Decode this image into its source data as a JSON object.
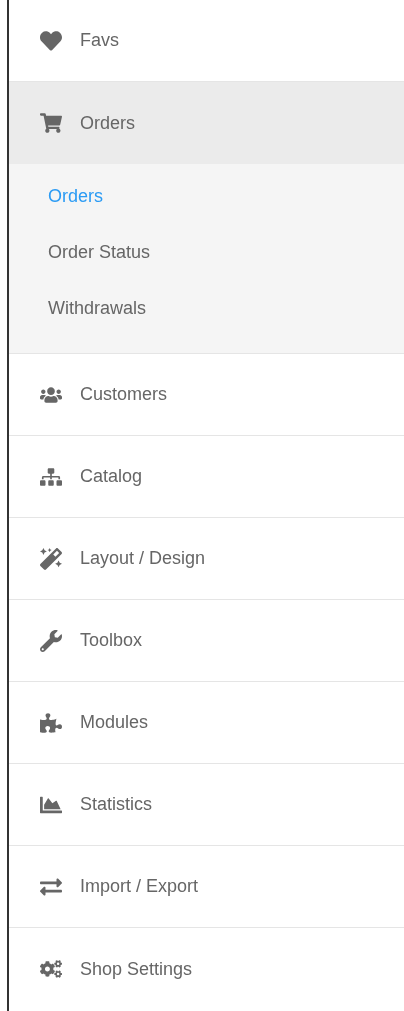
{
  "sidebar": {
    "items": [
      {
        "label": "Favs",
        "expanded": false
      },
      {
        "label": "Orders",
        "expanded": true,
        "children": [
          {
            "label": "Orders",
            "selected": true
          },
          {
            "label": "Order Status",
            "selected": false
          },
          {
            "label": "Withdrawals",
            "selected": false
          }
        ]
      },
      {
        "label": "Customers",
        "expanded": false
      },
      {
        "label": "Catalog",
        "expanded": false
      },
      {
        "label": "Layout / Design",
        "expanded": false
      },
      {
        "label": "Toolbox",
        "expanded": false
      },
      {
        "label": "Modules",
        "expanded": false
      },
      {
        "label": "Statistics",
        "expanded": false
      },
      {
        "label": "Import / Export",
        "expanded": false
      },
      {
        "label": "Shop Settings",
        "expanded": false
      }
    ]
  }
}
